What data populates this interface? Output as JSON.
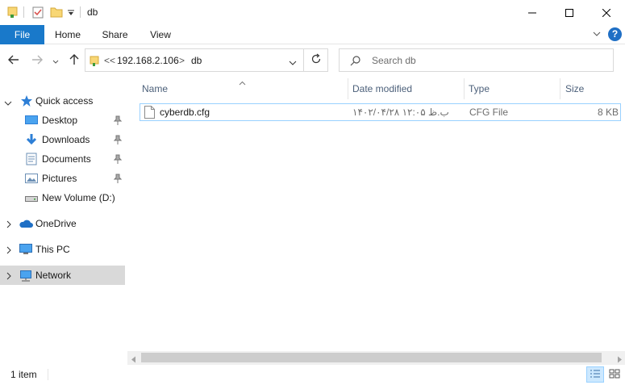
{
  "window": {
    "title": "db",
    "minimize_icon": "minimize-icon",
    "maximize_icon": "maximize-icon",
    "close_icon": "close-icon"
  },
  "ribbon": {
    "tabs": [
      {
        "label": "File"
      },
      {
        "label": "Home"
      },
      {
        "label": "Share"
      },
      {
        "label": "View"
      }
    ],
    "help_label": "?"
  },
  "address": {
    "overflow": "<<",
    "segments": [
      "192.168.2.106",
      "db"
    ],
    "separator": ">"
  },
  "search": {
    "placeholder": "Search db"
  },
  "sidebar": {
    "items": [
      {
        "label": "Quick access",
        "icon": "star-icon"
      },
      {
        "label": "Desktop",
        "icon": "desktop-icon"
      },
      {
        "label": "Downloads",
        "icon": "download-icon"
      },
      {
        "label": "Documents",
        "icon": "document-icon"
      },
      {
        "label": "Pictures",
        "icon": "pictures-icon"
      },
      {
        "label": "New Volume (D:)",
        "icon": "drive-icon"
      },
      {
        "label": "OneDrive",
        "icon": "cloud-icon"
      },
      {
        "label": "This PC",
        "icon": "computer-icon"
      },
      {
        "label": "Network",
        "icon": "network-icon"
      }
    ]
  },
  "columns": {
    "name": "Name",
    "date_modified": "Date modified",
    "type": "Type",
    "size": "Size"
  },
  "files": [
    {
      "name": "cyberdb.cfg",
      "date_modified": "۱۴۰۲/۰۴/۲۸ ب.ظ ۱۲:۰۵",
      "type": "CFG File",
      "size": "8 KB"
    }
  ],
  "status": {
    "item_count": "1 item"
  },
  "colors": {
    "accent": "#1979ca",
    "selection_border": "#99d1ff",
    "selected_nav": "#d9d9d9"
  }
}
